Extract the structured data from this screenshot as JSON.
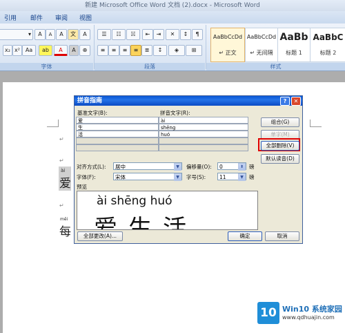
{
  "window": {
    "title": "新建 Microsoft Office Word 文档 (2).docx - Microsoft Word"
  },
  "ribbon_tabs": [
    "引用",
    "邮件",
    "审阅",
    "视图"
  ],
  "ribbon": {
    "font_group_label": "字体",
    "paragraph_group_label": "段落",
    "styles_group_label": "样式",
    "styles": [
      {
        "sample": "AaBbCcDd",
        "name": "↵ 正文"
      },
      {
        "sample": "AaBbCcDd",
        "name": "↵ 无间隔"
      },
      {
        "sample": "AaBb",
        "name": "标题 1"
      },
      {
        "sample": "AaBbC",
        "name": "标题 2"
      }
    ],
    "font_buttons": {
      "grow": "A",
      "shrink": "A",
      "clear": "A",
      "phonetic": "文",
      "border": "A",
      "sub": "x₂",
      "sup": "x²",
      "case": "Aa",
      "highlight": "ab",
      "color": "A",
      "shade": "A",
      "enclose": "⊕"
    }
  },
  "document": {
    "line1_pinyin": "ài",
    "line1_char": "爱",
    "line2_pinyin": "měi",
    "line2_char": "每"
  },
  "dialog": {
    "title": "拼音指南",
    "base_text_label": "基准文字(B):",
    "ruby_text_label": "拼音文字(R):",
    "rows": [
      {
        "base": "爱",
        "ruby": "ài"
      },
      {
        "base": "生",
        "ruby": "shēng"
      },
      {
        "base": "活",
        "ruby": "huó"
      },
      {
        "base": "",
        "ruby": ""
      },
      {
        "base": "",
        "ruby": ""
      }
    ],
    "buttons": {
      "combine": "组合(G)",
      "mono": "单字(M)",
      "clear_all": "全部删除(V)",
      "default_reading": "默认读音(D)",
      "change_all": "全部更改(A)...",
      "ok": "确定",
      "cancel": "取消"
    },
    "alignment_label": "对齐方式(L):",
    "alignment_value": "居中",
    "offset_label": "偏移量(O):",
    "offset_value": "0",
    "offset_unit": "磅",
    "font_label": "字体(F):",
    "font_value": "宋体",
    "size_label": "字号(S):",
    "size_value": "11",
    "size_unit": "磅",
    "preview_label": "预览",
    "preview_pinyin": "ài shēng huó",
    "preview_chars": "爱生活"
  },
  "watermark": {
    "brand": "Win10 系统家园",
    "url": "www.qdhuajin.com",
    "logo": "10"
  },
  "colors": {
    "highlight_red": "#e00000",
    "dialog_title": "#0a58d6"
  }
}
